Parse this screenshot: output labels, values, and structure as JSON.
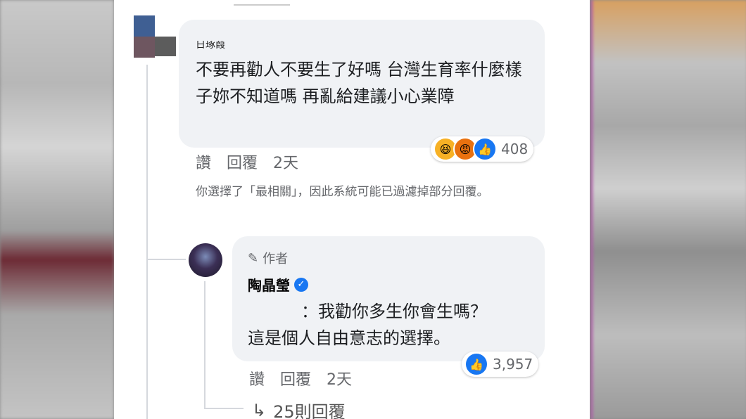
{
  "comment": {
    "name_partial": "日琢葭",
    "body": "不要再勸人不要生了好嗎 台灣生育率什麼樣子妳不知道嗎 再亂給建議小心業障",
    "reactions": {
      "icons": [
        "haha-icon",
        "angry-icon",
        "like-icon"
      ],
      "count": "408"
    },
    "actions": {
      "like": "讚",
      "reply": "回覆",
      "time": "2天"
    }
  },
  "filter_note": "你選擇了「最相關」，因此系統可能已過濾掉部分回覆。",
  "reply": {
    "author_label": "作者",
    "name": "陶晶瑩",
    "line1": "：我勸你多生你會生嗎？",
    "line2": "這是個人自由意志的選擇。",
    "reactions": {
      "count": "3,957"
    },
    "actions": {
      "like": "讚",
      "reply": "回覆",
      "time": "2天"
    }
  },
  "more_replies": "25則回覆",
  "colors": {
    "bubble": "#f0f2f5",
    "like_blue": "#1877f2",
    "meta_gray": "#65676b"
  }
}
